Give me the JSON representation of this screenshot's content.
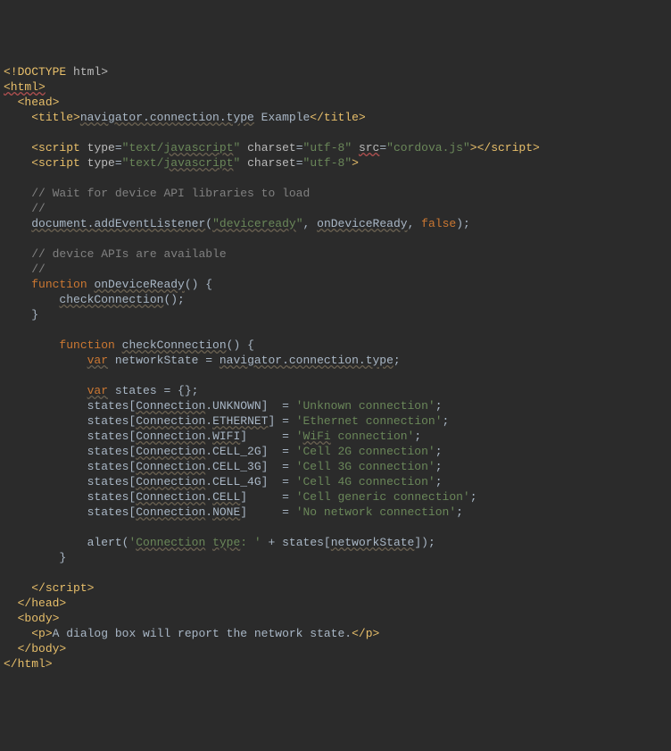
{
  "lines": [
    {
      "segs": [
        {
          "t": "<!DOCTYPE ",
          "c": "tag"
        },
        {
          "t": "html>",
          "c": "attr-name"
        }
      ]
    },
    {
      "segs": [
        {
          "t": "<html>",
          "c": "tag underline-red"
        }
      ]
    },
    {
      "segs": [
        {
          "t": "  ",
          "c": "default"
        },
        {
          "t": "<head>",
          "c": "tag"
        }
      ]
    },
    {
      "segs": [
        {
          "t": "    ",
          "c": "default"
        },
        {
          "t": "<title>",
          "c": "tag"
        },
        {
          "t": "navigator.connection.type",
          "c": "default underline"
        },
        {
          "t": " Example",
          "c": "default"
        },
        {
          "t": "</title>",
          "c": "tag"
        }
      ]
    },
    {
      "segs": [
        {
          "t": " ",
          "c": "default"
        }
      ]
    },
    {
      "segs": [
        {
          "t": "    ",
          "c": "default"
        },
        {
          "t": "<script ",
          "c": "tag"
        },
        {
          "t": "type",
          "c": "attr-name"
        },
        {
          "t": "=",
          "c": "attr-eq"
        },
        {
          "t": "\"text/",
          "c": "attr-val"
        },
        {
          "t": "javascript",
          "c": "attr-val underline"
        },
        {
          "t": "\" ",
          "c": "attr-val"
        },
        {
          "t": "charset",
          "c": "attr-name"
        },
        {
          "t": "=",
          "c": "attr-eq"
        },
        {
          "t": "\"utf-8\" ",
          "c": "attr-val"
        },
        {
          "t": "src",
          "c": "attr-name underline-red"
        },
        {
          "t": "=",
          "c": "attr-eq"
        },
        {
          "t": "\"cordova.js\"",
          "c": "attr-val"
        },
        {
          "t": "></script>",
          "c": "tag"
        }
      ]
    },
    {
      "segs": [
        {
          "t": "    ",
          "c": "default"
        },
        {
          "t": "<script ",
          "c": "tag"
        },
        {
          "t": "type",
          "c": "attr-name"
        },
        {
          "t": "=",
          "c": "attr-eq"
        },
        {
          "t": "\"text/",
          "c": "attr-val"
        },
        {
          "t": "javascript",
          "c": "attr-val underline"
        },
        {
          "t": "\" ",
          "c": "attr-val"
        },
        {
          "t": "charset",
          "c": "attr-name"
        },
        {
          "t": "=",
          "c": "attr-eq"
        },
        {
          "t": "\"utf-8\"",
          "c": "attr-val"
        },
        {
          "t": ">",
          "c": "tag"
        }
      ]
    },
    {
      "segs": [
        {
          "t": " ",
          "c": "default"
        }
      ]
    },
    {
      "segs": [
        {
          "t": "    ",
          "c": "default"
        },
        {
          "t": "// Wait for device API libraries to load",
          "c": "comment"
        }
      ]
    },
    {
      "segs": [
        {
          "t": "    ",
          "c": "default"
        },
        {
          "t": "//",
          "c": "comment"
        }
      ]
    },
    {
      "segs": [
        {
          "t": "    ",
          "c": "default"
        },
        {
          "t": "document.",
          "c": "default underline"
        },
        {
          "t": "addEventListener",
          "c": "default underline"
        },
        {
          "t": "(",
          "c": "default"
        },
        {
          "t": "\"",
          "c": "string underline"
        },
        {
          "t": "deviceready",
          "c": "string underline"
        },
        {
          "t": "\"",
          "c": "string"
        },
        {
          "t": ", ",
          "c": "default"
        },
        {
          "t": "onDeviceReady",
          "c": "default underline"
        },
        {
          "t": ", ",
          "c": "default"
        },
        {
          "t": "false",
          "c": "keyword"
        },
        {
          "t": ");",
          "c": "default"
        }
      ]
    },
    {
      "segs": [
        {
          "t": " ",
          "c": "default"
        }
      ]
    },
    {
      "segs": [
        {
          "t": "    ",
          "c": "default"
        },
        {
          "t": "// device APIs are available",
          "c": "comment"
        }
      ]
    },
    {
      "segs": [
        {
          "t": "    ",
          "c": "default"
        },
        {
          "t": "//",
          "c": "comment"
        }
      ]
    },
    {
      "segs": [
        {
          "t": "    ",
          "c": "default"
        },
        {
          "t": "function ",
          "c": "keyword"
        },
        {
          "t": "onDeviceReady",
          "c": "default func-underline"
        },
        {
          "t": "() {",
          "c": "default"
        }
      ]
    },
    {
      "segs": [
        {
          "t": "        ",
          "c": "default"
        },
        {
          "t": "checkConnection",
          "c": "default underline"
        },
        {
          "t": "();",
          "c": "default"
        }
      ]
    },
    {
      "segs": [
        {
          "t": "    }",
          "c": "default"
        }
      ]
    },
    {
      "segs": [
        {
          "t": " ",
          "c": "default"
        }
      ]
    },
    {
      "segs": [
        {
          "t": "        ",
          "c": "default"
        },
        {
          "t": "function ",
          "c": "keyword"
        },
        {
          "t": "checkConnection",
          "c": "default func-underline"
        },
        {
          "t": "() {",
          "c": "default"
        }
      ]
    },
    {
      "segs": [
        {
          "t": "            ",
          "c": "default"
        },
        {
          "t": "var",
          "c": "keyword underline"
        },
        {
          "t": " networkState = ",
          "c": "default"
        },
        {
          "t": "navigator.",
          "c": "default underline"
        },
        {
          "t": "connection.type",
          "c": "default underline"
        },
        {
          "t": ";",
          "c": "default"
        }
      ]
    },
    {
      "segs": [
        {
          "t": " ",
          "c": "default"
        }
      ]
    },
    {
      "segs": [
        {
          "t": "            ",
          "c": "default"
        },
        {
          "t": "var",
          "c": "keyword underline"
        },
        {
          "t": " states = {};",
          "c": "default"
        }
      ]
    },
    {
      "segs": [
        {
          "t": "            states[",
          "c": "default"
        },
        {
          "t": "Connection",
          "c": "default underline"
        },
        {
          "t": ".UNKNOWN]  = ",
          "c": "default"
        },
        {
          "t": "'Unknown connection'",
          "c": "string"
        },
        {
          "t": ";",
          "c": "default"
        }
      ]
    },
    {
      "segs": [
        {
          "t": "            states[",
          "c": "default"
        },
        {
          "t": "Connection",
          "c": "default underline"
        },
        {
          "t": ".",
          "c": "default"
        },
        {
          "t": "ETHERNET",
          "c": "default underline"
        },
        {
          "t": "] = ",
          "c": "default"
        },
        {
          "t": "'Ethernet connection'",
          "c": "string"
        },
        {
          "t": ";",
          "c": "default"
        }
      ]
    },
    {
      "segs": [
        {
          "t": "            states[",
          "c": "default"
        },
        {
          "t": "Connection",
          "c": "default underline"
        },
        {
          "t": ".",
          "c": "default"
        },
        {
          "t": "WIFI",
          "c": "default underline"
        },
        {
          "t": "]     = ",
          "c": "default"
        },
        {
          "t": "'",
          "c": "string"
        },
        {
          "t": "WiFi",
          "c": "string underline"
        },
        {
          "t": " connection'",
          "c": "string"
        },
        {
          "t": ";",
          "c": "default"
        }
      ]
    },
    {
      "segs": [
        {
          "t": "            states[",
          "c": "default"
        },
        {
          "t": "Connection",
          "c": "default underline"
        },
        {
          "t": ".CELL_2G]  = ",
          "c": "default"
        },
        {
          "t": "'Cell 2G connection'",
          "c": "string"
        },
        {
          "t": ";",
          "c": "default"
        }
      ]
    },
    {
      "segs": [
        {
          "t": "            states[",
          "c": "default"
        },
        {
          "t": "Connection",
          "c": "default underline"
        },
        {
          "t": ".CELL_3G]  = ",
          "c": "default"
        },
        {
          "t": "'Cell 3G connection'",
          "c": "string"
        },
        {
          "t": ";",
          "c": "default"
        }
      ]
    },
    {
      "segs": [
        {
          "t": "            states[",
          "c": "default"
        },
        {
          "t": "Connection",
          "c": "default underline"
        },
        {
          "t": ".CELL_4G]  = ",
          "c": "default"
        },
        {
          "t": "'Cell 4G connection'",
          "c": "string"
        },
        {
          "t": ";",
          "c": "default"
        }
      ]
    },
    {
      "segs": [
        {
          "t": "            states[",
          "c": "default"
        },
        {
          "t": "Connection",
          "c": "default underline"
        },
        {
          "t": ".",
          "c": "default"
        },
        {
          "t": "CELL",
          "c": "default underline"
        },
        {
          "t": "]     = ",
          "c": "default"
        },
        {
          "t": "'Cell generic connection'",
          "c": "string"
        },
        {
          "t": ";",
          "c": "default"
        }
      ]
    },
    {
      "segs": [
        {
          "t": "            states[",
          "c": "default"
        },
        {
          "t": "Connection",
          "c": "default underline"
        },
        {
          "t": ".",
          "c": "default"
        },
        {
          "t": "NONE",
          "c": "default underline"
        },
        {
          "t": "]     = ",
          "c": "default"
        },
        {
          "t": "'No network connection'",
          "c": "string"
        },
        {
          "t": ";",
          "c": "default"
        }
      ]
    },
    {
      "segs": [
        {
          "t": " ",
          "c": "default"
        }
      ]
    },
    {
      "segs": [
        {
          "t": "            alert(",
          "c": "default"
        },
        {
          "t": "'",
          "c": "string"
        },
        {
          "t": "Connection",
          "c": "string underline"
        },
        {
          "t": " ",
          "c": "string"
        },
        {
          "t": "type",
          "c": "string underline"
        },
        {
          "t": ": ' ",
          "c": "string"
        },
        {
          "t": "+ states[",
          "c": "default"
        },
        {
          "t": "networkState",
          "c": "default underline"
        },
        {
          "t": "]);",
          "c": "default"
        }
      ]
    },
    {
      "segs": [
        {
          "t": "        }",
          "c": "default"
        }
      ]
    },
    {
      "segs": [
        {
          "t": " ",
          "c": "default"
        }
      ]
    },
    {
      "segs": [
        {
          "t": "    ",
          "c": "default"
        },
        {
          "t": "</script>",
          "c": "tag"
        }
      ]
    },
    {
      "segs": [
        {
          "t": "  ",
          "c": "default"
        },
        {
          "t": "</head>",
          "c": "tag"
        }
      ]
    },
    {
      "segs": [
        {
          "t": "  ",
          "c": "default"
        },
        {
          "t": "<body>",
          "c": "tag"
        }
      ]
    },
    {
      "segs": [
        {
          "t": "    ",
          "c": "default"
        },
        {
          "t": "<p>",
          "c": "tag"
        },
        {
          "t": "A dialog box will report the network state.",
          "c": "default"
        },
        {
          "t": "</p>",
          "c": "tag"
        }
      ]
    },
    {
      "segs": [
        {
          "t": "  ",
          "c": "default"
        },
        {
          "t": "</body>",
          "c": "tag"
        }
      ]
    },
    {
      "segs": [
        {
          "t": "</html>",
          "c": "tag"
        }
      ]
    }
  ]
}
